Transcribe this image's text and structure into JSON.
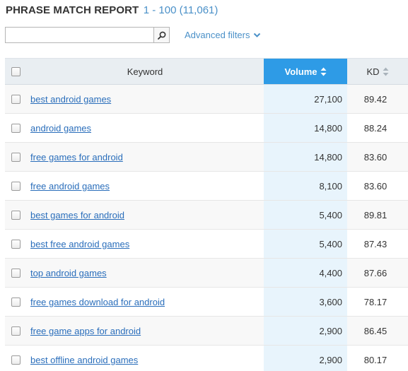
{
  "report": {
    "title": "PHRASE MATCH REPORT",
    "range": "1 - 100 (11,061)"
  },
  "search": {
    "value": "",
    "placeholder": "",
    "icon": "search-icon"
  },
  "filters": {
    "label": "Advanced filters",
    "icon": "chevron-down-icon"
  },
  "table": {
    "columns": {
      "keyword": "Keyword",
      "volume": "Volume",
      "kd": "KD"
    },
    "sorted_column": "Volume",
    "colors": {
      "accent": "#2e9be6",
      "link": "#2a6ebb",
      "volume_bg": "#e8f4fc"
    },
    "rows": [
      {
        "keyword": "best android games",
        "volume": "27,100",
        "kd": "89.42"
      },
      {
        "keyword": "android games",
        "volume": "14,800",
        "kd": "88.24"
      },
      {
        "keyword": "free games for android",
        "volume": "14,800",
        "kd": "83.60"
      },
      {
        "keyword": "free android games",
        "volume": "8,100",
        "kd": "83.60"
      },
      {
        "keyword": "best games for android",
        "volume": "5,400",
        "kd": "89.81"
      },
      {
        "keyword": "best free android games",
        "volume": "5,400",
        "kd": "87.43"
      },
      {
        "keyword": "top android games",
        "volume": "4,400",
        "kd": "87.66"
      },
      {
        "keyword": "free games download for android",
        "volume": "3,600",
        "kd": "78.17"
      },
      {
        "keyword": "free game apps for android",
        "volume": "2,900",
        "kd": "86.45"
      },
      {
        "keyword": "best offline android games",
        "volume": "2,900",
        "kd": "80.17"
      }
    ]
  }
}
